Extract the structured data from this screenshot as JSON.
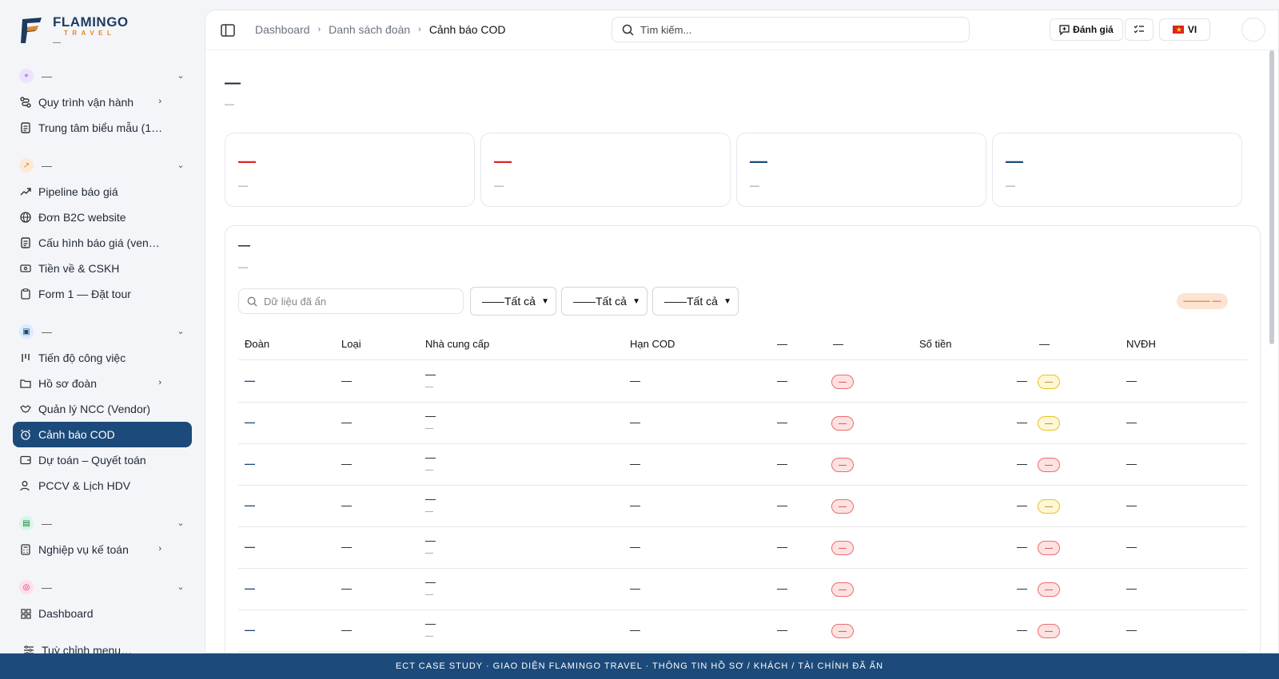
{
  "brand": {
    "name": "FLAMINGO",
    "sub": "TRAVEL",
    "extra": "—"
  },
  "colors": {
    "primary": "#1c4a7a",
    "danger": "#dc2626",
    "accent": "#e4862b"
  },
  "sidebar": {
    "groups": [
      {
        "label": "—",
        "icon": "flow-icon"
      },
      {
        "label": "—",
        "icon": "trend-icon"
      },
      {
        "label": "—",
        "icon": "briefcase-icon"
      },
      {
        "label": "—",
        "icon": "calculator-icon"
      },
      {
        "label": "—",
        "icon": "globe-icon"
      }
    ],
    "items": [
      {
        "label": "Quy trình vận hành",
        "icon": "route-icon"
      },
      {
        "label": "Trung tâm biểu mẫu (1.1…",
        "icon": "document-icon"
      },
      {
        "label": "Pipeline báo giá",
        "icon": "trend-icon"
      },
      {
        "label": "Đơn B2C website",
        "icon": "globe-icon"
      },
      {
        "label": "Cấu hình báo giá (vend…",
        "icon": "document-icon"
      },
      {
        "label": "Tiền về & CSKH",
        "icon": "banknote-icon"
      },
      {
        "label": "Form 1 — Đặt tour",
        "icon": "clipboard-icon"
      },
      {
        "label": "Tiến độ công việc",
        "icon": "kanban-icon"
      },
      {
        "label": "Hồ sơ đoàn",
        "icon": "folder-icon"
      },
      {
        "label": "Quản lý NCC (Vendor)",
        "icon": "handshake-icon"
      },
      {
        "label": "Cảnh báo COD",
        "icon": "alarm-icon"
      },
      {
        "label": "Dự toán – Quyết toán",
        "icon": "wallet-icon"
      },
      {
        "label": "PCCV & Lịch HDV",
        "icon": "users-icon"
      },
      {
        "label": "Nghiệp vụ kế toán",
        "icon": "calculator-icon"
      },
      {
        "label": "Dashboard",
        "icon": "grid-icon"
      }
    ],
    "customize": "Tuỳ chỉnh menu…"
  },
  "topbar": {
    "breadcrumb": [
      "Dashboard",
      "Danh sách đoàn",
      "Cảnh báo COD"
    ],
    "search_placeholder": "Tìm kiếm...",
    "rate_label": "Đánh giá",
    "lang_label": "VI"
  },
  "page": {
    "title": "—",
    "subtitle": "—"
  },
  "stats": [
    {
      "value": "—",
      "label": "—",
      "color": "#dc2626"
    },
    {
      "value": "—",
      "label": "—",
      "color": "#dc2626"
    },
    {
      "value": "—",
      "label": "—",
      "color": "#1c4a7a"
    },
    {
      "value": "—",
      "label": "—",
      "color": "#1c4a7a"
    }
  ],
  "panel": {
    "title": "—",
    "subtitle": "—",
    "search_placeholder": "Dữ liệu đã ẩn",
    "filters": [
      "——Tất cả",
      "——Tất cả",
      "——Tất cả"
    ],
    "count_badge": "——— —"
  },
  "table": {
    "columns": [
      "Đoàn",
      "Loại",
      "Nhà cung cấp",
      "Hạn COD",
      "—",
      "—",
      "Số tiền",
      "—",
      "NVĐH"
    ],
    "rows": [
      {
        "doan": "—",
        "loai": "—",
        "ncc": "—",
        "ncc_sub": "—",
        "han": "—",
        "c5": "—",
        "status": "—",
        "amount": "—",
        "flag": "—",
        "flag_color": "yellow",
        "nv": "—"
      },
      {
        "doan": "—",
        "loai": "—",
        "ncc": "—",
        "ncc_sub": "—",
        "han": "—",
        "c5": "—",
        "status": "—",
        "amount": "—",
        "flag": "—",
        "flag_color": "yellow",
        "nv": "—"
      },
      {
        "doan": "—",
        "loai": "—",
        "ncc": "—",
        "ncc_sub": "—",
        "han": "—",
        "c5": "—",
        "status": "—",
        "amount": "—",
        "flag": "—",
        "flag_color": "red",
        "nv": "—"
      },
      {
        "doan": "—",
        "loai": "—",
        "ncc": "—",
        "ncc_sub": "—",
        "han": "—",
        "c5": "—",
        "status": "—",
        "amount": "—",
        "flag": "—",
        "flag_color": "yellow",
        "nv": "—"
      },
      {
        "doan": "—",
        "loai": "—",
        "ncc": "—",
        "ncc_sub": "—",
        "han": "—",
        "c5": "—",
        "status": "—",
        "amount": "—",
        "flag": "—",
        "flag_color": "red",
        "nv": "—"
      },
      {
        "doan": "—",
        "loai": "—",
        "ncc": "—",
        "ncc_sub": "—",
        "han": "—",
        "c5": "—",
        "status": "—",
        "amount": "—",
        "flag": "—",
        "flag_color": "red",
        "nv": "—"
      },
      {
        "doan": "—",
        "loai": "—",
        "ncc": "—",
        "ncc_sub": "—",
        "han": "—",
        "c5": "—",
        "status": "—",
        "amount": "—",
        "flag": "—",
        "flag_color": "red",
        "nv": "—"
      }
    ]
  },
  "footer": "ECT CASE STUDY · GIAO DIỆN FLAMINGO TRAVEL · THÔNG TIN HỒ SƠ / KHÁCH / TÀI CHÍNH ĐÃ ẨN"
}
